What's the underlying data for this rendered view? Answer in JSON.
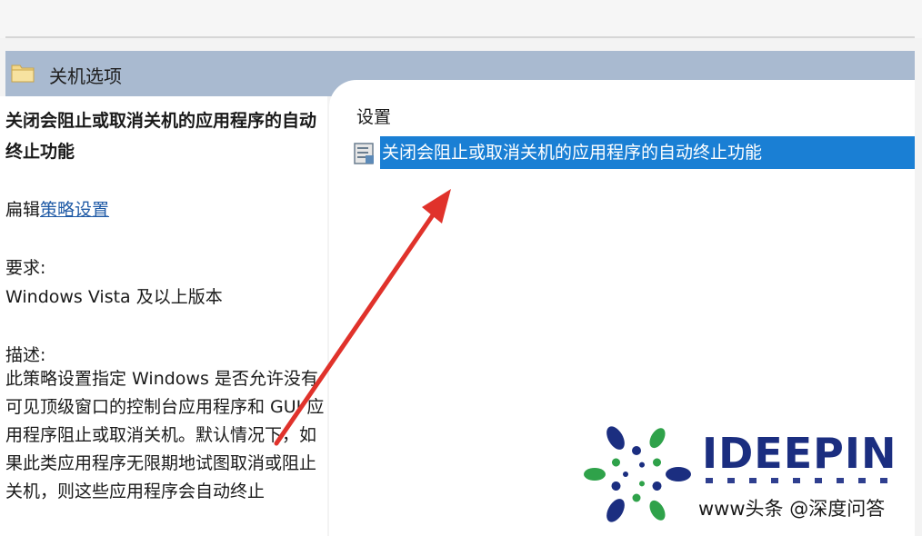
{
  "header": {
    "title": "关机选项"
  },
  "left_pane": {
    "title": "关闭会阻止或取消关机的应用程序的自动终止功能",
    "edit_prefix": "扁辑",
    "edit_link": "策略设置",
    "requirements_label": "要求:",
    "requirements_value": "Windows Vista 及以上版本",
    "description_label": "描述:",
    "description_text": "此策略设置指定 Windows 是否允许没有可见顶级窗口的控制台应用程序和 GUI 应用程序阻止或取消关机。默认情况下，如果此类应用程序无限期地试图取消或阻止关机，则这些应用程序会自动终止"
  },
  "right_pane": {
    "settings_label": "设置",
    "selected_item": "关闭会阻止或取消关机的应用程序的自动终止功能"
  },
  "logo": {
    "brand": "IDEEPIN",
    "watermark": "www头条 @深度问答",
    "brand_color": "#1b2e80"
  },
  "colors": {
    "header_bar": "#a9bad0",
    "selection": "#1a7fd4",
    "arrow": "#e0322b",
    "link": "#1f5aa6"
  }
}
